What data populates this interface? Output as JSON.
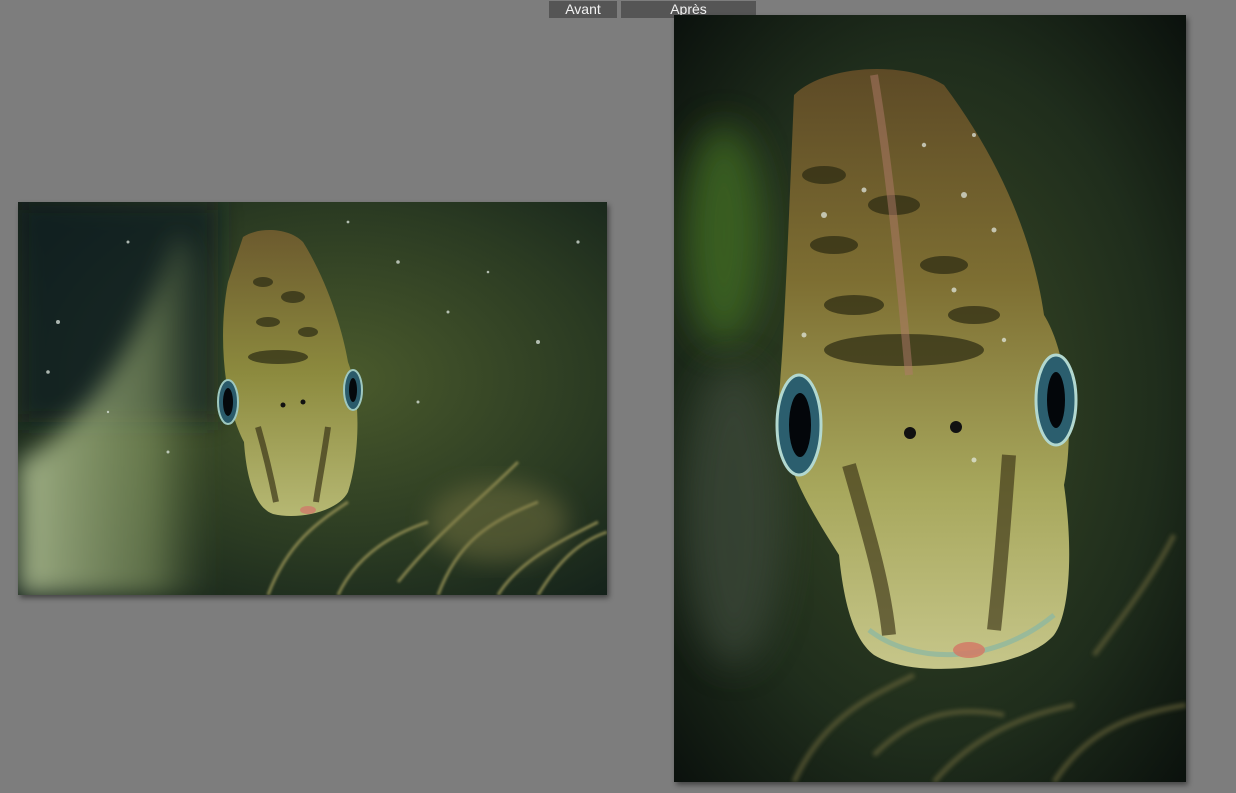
{
  "compare_view": {
    "before_label": "Avant",
    "after_label": "Après"
  },
  "colors": {
    "workspace_background": "#7d7d7d",
    "tab_background": "#555555",
    "tab_text": "#f2f2f2"
  },
  "photos": {
    "before": {
      "subject": "fish-portrait-landscape"
    },
    "after": {
      "subject": "fish-portrait-vertical-crop"
    }
  }
}
